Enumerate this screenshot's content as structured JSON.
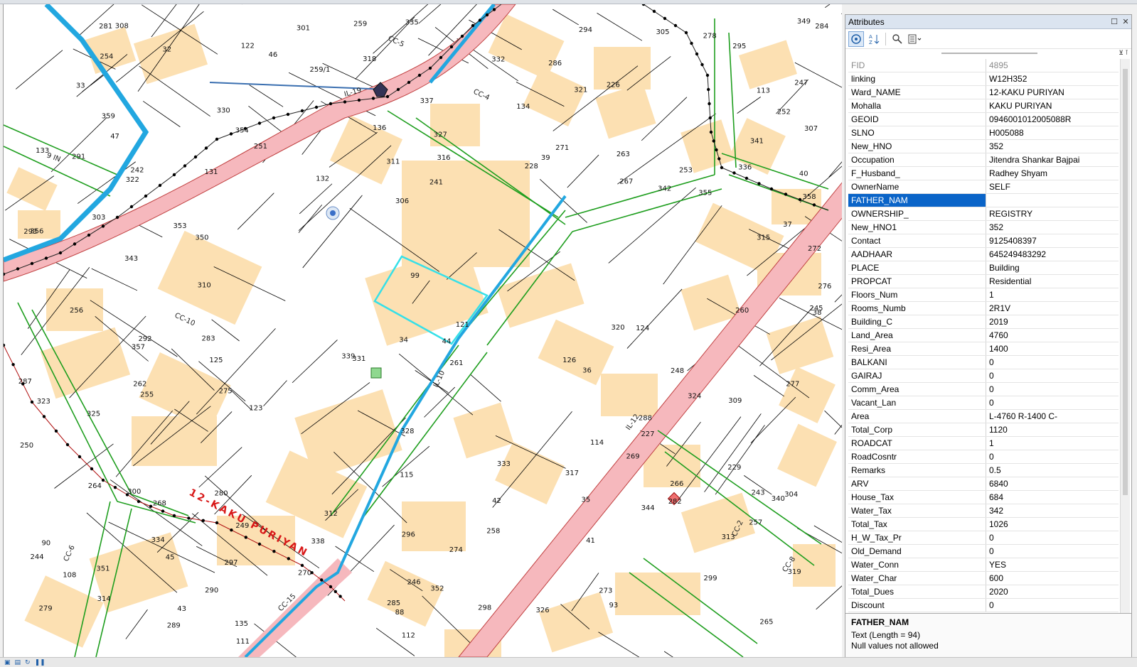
{
  "panel": {
    "title": "Attributes",
    "controls": {
      "pin": "☐",
      "close": "✕"
    }
  },
  "toolbar": {
    "icons": [
      "identify-icon",
      "sort-icon",
      "find-icon",
      "list-icon"
    ]
  },
  "attributes": [
    {
      "name": "FID",
      "value": "4895",
      "readonly": true
    },
    {
      "name": "linking",
      "value": "W12H352"
    },
    {
      "name": "Ward_NAME",
      "value": "12-KAKU PURIYAN"
    },
    {
      "name": "Mohalla",
      "value": "KAKU PURIYAN"
    },
    {
      "name": "GEOID",
      "value": "0946001012005088R"
    },
    {
      "name": "SLNO",
      "value": "H005088"
    },
    {
      "name": "New_HNO",
      "value": "352"
    },
    {
      "name": "Occupation",
      "value": "Jitendra Shankar Bajpai"
    },
    {
      "name": "F_Husband_",
      "value": "Radhey Shyam"
    },
    {
      "name": "OwnerName",
      "value": "SELF"
    },
    {
      "name": "FATHER_NAM",
      "value": "",
      "selected": true
    },
    {
      "name": "OWNERSHIP_",
      "value": "REGISTRY"
    },
    {
      "name": "New_HNO1",
      "value": "352"
    },
    {
      "name": "Contact",
      "value": "9125408397"
    },
    {
      "name": "AADHAAR",
      "value": "645249483292"
    },
    {
      "name": "PLACE",
      "value": "Building"
    },
    {
      "name": "PROPCAT",
      "value": "Residential"
    },
    {
      "name": "Floors_Num",
      "value": "1"
    },
    {
      "name": "Rooms_Numb",
      "value": "2R1V"
    },
    {
      "name": "Building_C",
      "value": "2019"
    },
    {
      "name": "Land_Area",
      "value": "4760"
    },
    {
      "name": "Resi_Area",
      "value": "1400"
    },
    {
      "name": "BALKANI",
      "value": "0"
    },
    {
      "name": "GAIRAJ",
      "value": "0"
    },
    {
      "name": "Comm_Area",
      "value": "0"
    },
    {
      "name": "Vacant_Lan",
      "value": "0"
    },
    {
      "name": "Area",
      "value": "L-4760 R-1400 C-"
    },
    {
      "name": "Total_Corp",
      "value": "1120"
    },
    {
      "name": "ROADCAT",
      "value": "1"
    },
    {
      "name": "RoadCosntr",
      "value": "0"
    },
    {
      "name": "Remarks",
      "value": "0.5"
    },
    {
      "name": "ARV",
      "value": "6840"
    },
    {
      "name": "House_Tax",
      "value": "684"
    },
    {
      "name": "Water_Tax",
      "value": "342"
    },
    {
      "name": "Total_Tax",
      "value": "1026"
    },
    {
      "name": "H_W_Tax_Pr",
      "value": "0"
    },
    {
      "name": "Old_Demand",
      "value": "0"
    },
    {
      "name": "Water_Conn",
      "value": "YES"
    },
    {
      "name": "Water_Char",
      "value": "600"
    },
    {
      "name": "Total_Dues",
      "value": "2020"
    },
    {
      "name": "Discount",
      "value": "0"
    }
  ],
  "description": {
    "field": "FATHER_NAM",
    "type": "Text (Length = 94)",
    "nulls": "Null values not allowed"
  },
  "map": {
    "colors": {
      "parcel_fill": "#fce0b2",
      "parcel_line": "#000000",
      "road_line": "#1e9e1e",
      "main_road_fill": "#f6b8bd",
      "canal": "#22a7e0",
      "selection": "#36e0e8",
      "ward_text": "#d81818"
    },
    "ward_label": "12-KAKU PURIYAN",
    "road_labels": [
      "IL-19",
      "IL-12",
      "IL-10",
      "CC-10",
      "CC-5",
      "CC-4",
      "CC-6",
      "CC-2",
      "CC-8",
      "CC-15",
      "9 IN"
    ],
    "parcel_labels": [
      "99",
      "88",
      "93",
      "90",
      "307",
      "308",
      "305",
      "306",
      "304",
      "303",
      "123",
      "121",
      "122",
      "124",
      "125",
      "126",
      "131",
      "132",
      "134",
      "133",
      "135",
      "136",
      "115",
      "111",
      "112",
      "113",
      "114",
      "108",
      "317",
      "315",
      "316",
      "351",
      "350",
      "353",
      "352",
      "349",
      "331",
      "330",
      "328",
      "327",
      "326",
      "325",
      "324",
      "323",
      "322",
      "321",
      "320",
      "319",
      "318",
      "314",
      "313",
      "312",
      "311",
      "310",
      "309",
      "300",
      "301",
      "297",
      "296",
      "298",
      "299",
      "282",
      "283",
      "284",
      "285",
      "286",
      "287",
      "288",
      "289",
      "290",
      "291",
      "292",
      "293",
      "294",
      "295",
      "271",
      "272",
      "273",
      "274",
      "275",
      "276",
      "277",
      "278",
      "279",
      "280",
      "281",
      "268",
      "269",
      "270",
      "267",
      "266",
      "265",
      "264",
      "263",
      "262",
      "261",
      "260",
      "259/1",
      "259",
      "258",
      "257",
      "256",
      "255",
      "254",
      "253",
      "252",
      "251",
      "250",
      "249",
      "248",
      "247",
      "246",
      "245",
      "244",
      "243",
      "242",
      "241",
      "229",
      "228",
      "227",
      "226",
      "344",
      "343",
      "342",
      "341",
      "340",
      "339",
      "338",
      "337",
      "336",
      "335",
      "334",
      "333",
      "332",
      "354",
      "355",
      "356",
      "357",
      "358",
      "359",
      "47",
      "46",
      "45",
      "44",
      "43",
      "42",
      "41",
      "40",
      "39",
      "38",
      "37",
      "36",
      "35",
      "34",
      "33",
      "32"
    ]
  }
}
